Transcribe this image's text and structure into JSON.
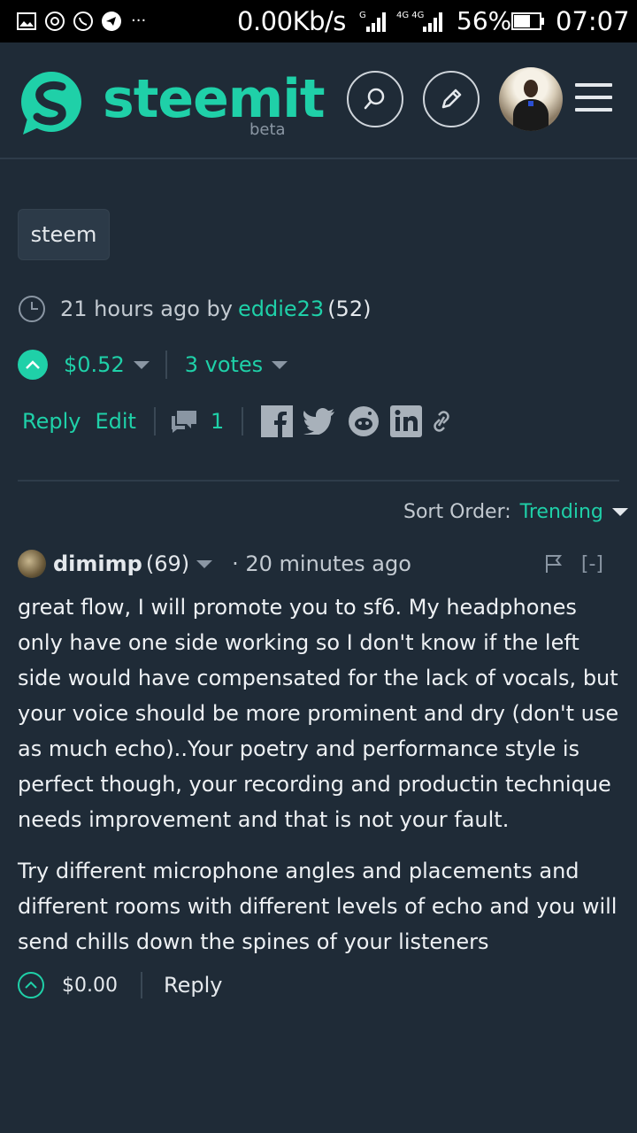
{
  "status_bar": {
    "speed": "0.00Kb/s",
    "battery_pct": "56%",
    "time": "07:07",
    "sim1_label": "G",
    "sim2_label": "4G 4G",
    "icons": [
      "gallery-icon",
      "sync-icon",
      "whatsapp-icon",
      "telegram-icon",
      "more-icon"
    ],
    "more": "···"
  },
  "header": {
    "logo_text": "steemit",
    "beta": "beta",
    "accent": "#1fd0a8"
  },
  "post": {
    "tag": "steem",
    "time_ago": "21 hours ago by",
    "author": "eddie23",
    "reputation": "(52)",
    "payout": "$0.52",
    "votes": "3 votes",
    "reply_label": "Reply",
    "edit_label": "Edit",
    "comment_count": "1"
  },
  "sort": {
    "label": "Sort Order:",
    "value": "Trending"
  },
  "comment": {
    "author": "dimimp",
    "reputation": "(69)",
    "time": "· 20 minutes ago",
    "collapse": "[-]",
    "paragraphs": [
      "great flow, I will promote you to sf6. My headphones only have one side working so I don't know if the left side would have compensated for the lack of vocals, but your voice should be more prominent and dry (don't use as much echo)..Your poetry and performance style is perfect though, your recording and productin technique needs improvement and that is not your fault.",
      "Try different microphone angles and placements and different rooms with different levels of echo and you will send chills down the spines of your listeners"
    ],
    "payout": "$0.00",
    "reply_label": "Reply"
  }
}
